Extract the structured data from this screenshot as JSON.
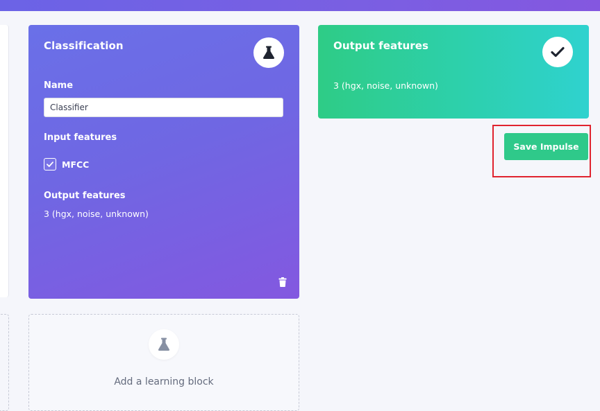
{
  "learning_block": {
    "title": "Classification",
    "icon": "flask-icon",
    "name_label": "Name",
    "name_value": "Classifier",
    "input_features_label": "Input features",
    "input_features": [
      {
        "label": "MFCC",
        "checked": true
      }
    ],
    "output_features_label": "Output features",
    "output_features_value": "3 (hgx, noise, unknown)",
    "delete_icon": "trash-icon",
    "accent_gradient": [
      "#6a70e8",
      "#8358e0"
    ]
  },
  "output_block": {
    "title": "Output features",
    "icon": "checkmark-icon",
    "value": "3 (hgx, noise, unknown)",
    "accent_gradient": [
      "#2ecc86",
      "#2fd2cf"
    ]
  },
  "actions": {
    "save_label": "Save Impulse",
    "save_color": "#2fc98a",
    "highlight_color": "#e0232e"
  },
  "add_block": {
    "label": "Add a learning block",
    "icon": "flask-icon"
  }
}
